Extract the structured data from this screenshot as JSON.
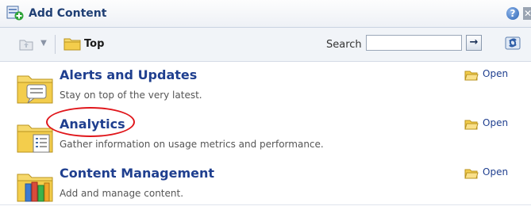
{
  "header": {
    "title": "Add Content",
    "help_glyph": "?",
    "close_glyph": "✕",
    "icons": [
      "add-content-icon",
      "help-icon",
      "close-icon"
    ]
  },
  "toolbar": {
    "breadcrumb": "Top",
    "search_label": "Search",
    "search_value": "",
    "go_glyph": "→",
    "icons": [
      "up-folder-icon",
      "dropdown-icon",
      "folder-icon",
      "go-arrow-icon",
      "refresh-icon"
    ]
  },
  "items": [
    {
      "name": "Alerts and Updates",
      "description": "Stay on top of the very latest.",
      "open_label": "Open",
      "icon": "alerts-folder-icon"
    },
    {
      "name": "Analytics",
      "description": "Gather information on usage metrics and performance.",
      "open_label": "Open",
      "icon": "analytics-folder-icon"
    },
    {
      "name": "Content Management",
      "description": "Add and manage content.",
      "open_label": "Open",
      "icon": "content-folder-icon"
    }
  ],
  "colors": {
    "link": "#1f3f8f",
    "highlight": "#e0161b",
    "folder": "#f2c94c"
  }
}
